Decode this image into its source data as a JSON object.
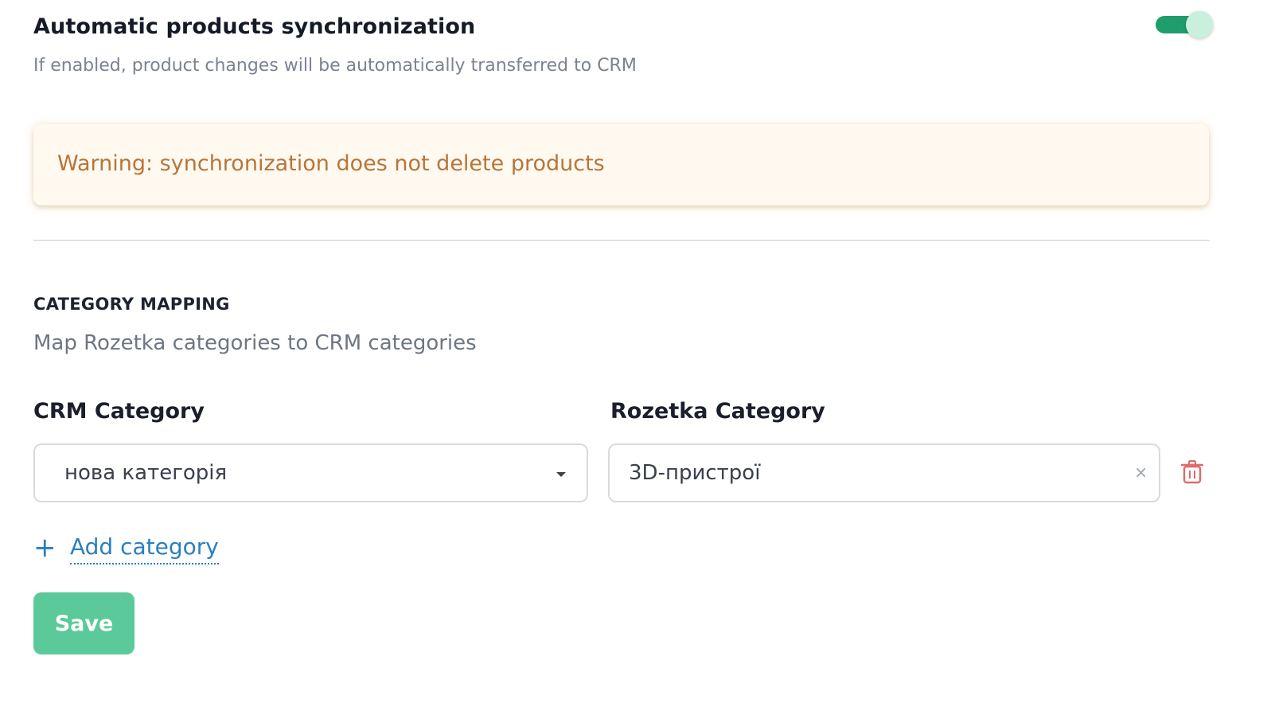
{
  "sync": {
    "title": "Automatic products synchronization",
    "description": "If enabled, product changes will be automatically transferred to CRM",
    "enabled": true
  },
  "warning": {
    "text": "Warning: synchronization does not delete products"
  },
  "mapping": {
    "title": "CATEGORY MAPPING",
    "description": "Map Rozetka categories to CRM categories",
    "crm_label": "CRM Category",
    "rozetka_label": "Rozetka Category",
    "rows": [
      {
        "crm_value": "нова категорія",
        "rozetka_value": "3D-пристрої"
      }
    ],
    "add_label": "Add category",
    "add_symbol": "+",
    "clear_symbol": "×"
  },
  "actions": {
    "save_label": "Save"
  },
  "colors": {
    "toggle_on": "#1f9e6b",
    "warning_text": "#b8753a",
    "link": "#2b7fc0",
    "save_button": "#5cc99b",
    "delete_icon": "#e06a6a"
  },
  "icons": {
    "toggle": "toggle-switch",
    "dropdown": "chevron-down-icon",
    "clear": "close-icon",
    "delete": "trash-icon",
    "add": "plus-icon"
  }
}
